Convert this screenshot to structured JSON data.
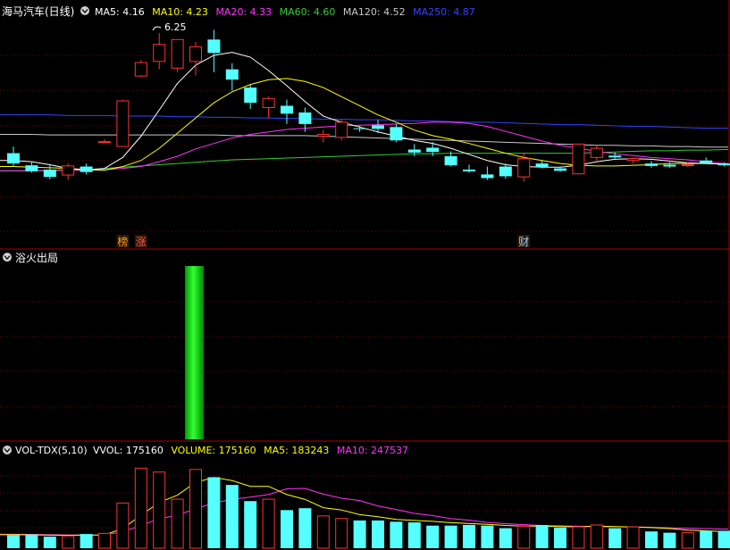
{
  "price_panel": {
    "title": "海马汽车(日线)",
    "indicators": [
      {
        "label": "MA5: 4.16",
        "color": "#ffffff"
      },
      {
        "label": "MA10: 4.23",
        "color": "#ffff00"
      },
      {
        "label": "MA20: 4.33",
        "color": "#ff33ff"
      },
      {
        "label": "MA60: 4.60",
        "color": "#33cc33"
      },
      {
        "label": "MA120: 4.52",
        "color": "#c8c8c8"
      },
      {
        "label": "MA250: 4.87",
        "color": "#3344ff"
      }
    ],
    "high_marker": "6.25",
    "badges": [
      {
        "text": "榜",
        "index": 6,
        "color": "#ff9933"
      },
      {
        "text": "涨",
        "index": 7,
        "color": "#ff5555"
      },
      {
        "text": "财",
        "index": 28,
        "color": "#99ccff"
      }
    ]
  },
  "signal_panel": {
    "title": "浴火出局",
    "signal_index": 10,
    "signal_level": 1.0
  },
  "volume_panel": {
    "title": "VOL-TDX(5,10)",
    "indicators": [
      {
        "label": "VVOL: 175160",
        "color": "#ffffff"
      },
      {
        "label": "VOLUME: 175160",
        "color": "#ffff00"
      },
      {
        "label": "MA5: 183243",
        "color": "#ffff00"
      },
      {
        "label": "MA10: 247537",
        "color": "#ff33ff"
      }
    ]
  },
  "colors": {
    "up": "#ff3333",
    "down": "#55ffff",
    "grid": "#7a0000",
    "ma5": "#ffffff",
    "ma10": "#ffff00",
    "ma20": "#ff33ff",
    "ma60": "#33cc33",
    "ma120": "#c8c8c8",
    "ma250": "#3344ff"
  },
  "chart_data": {
    "type": "candlestick",
    "price_range": [
      3.0,
      6.35
    ],
    "candles": [
      {
        "o": 4.27,
        "h": 4.38,
        "l": 4.05,
        "c": 4.1
      },
      {
        "o": 4.07,
        "h": 4.12,
        "l": 3.95,
        "c": 3.97
      },
      {
        "o": 4.0,
        "h": 4.07,
        "l": 3.84,
        "c": 3.88
      },
      {
        "o": 3.91,
        "h": 4.1,
        "l": 3.83,
        "c": 4.06
      },
      {
        "o": 4.05,
        "h": 4.1,
        "l": 3.92,
        "c": 3.96
      },
      {
        "o": 4.46,
        "h": 4.5,
        "l": 4.46,
        "c": 4.46
      },
      {
        "o": 4.38,
        "h": 5.15,
        "l": 4.38,
        "c": 5.13
      },
      {
        "o": 5.54,
        "h": 5.8,
        "l": 5.52,
        "c": 5.76
      },
      {
        "o": 5.78,
        "h": 6.25,
        "l": 5.65,
        "c": 6.06
      },
      {
        "o": 5.67,
        "h": 6.1,
        "l": 5.6,
        "c": 6.14
      },
      {
        "o": 5.78,
        "h": 6.1,
        "l": 5.55,
        "c": 6.02
      },
      {
        "o": 6.14,
        "h": 6.3,
        "l": 5.6,
        "c": 5.92
      },
      {
        "o": 5.65,
        "h": 5.75,
        "l": 5.3,
        "c": 5.48
      },
      {
        "o": 5.35,
        "h": 5.4,
        "l": 5.0,
        "c": 5.1
      },
      {
        "o": 5.02,
        "h": 5.2,
        "l": 4.85,
        "c": 5.17
      },
      {
        "o": 5.05,
        "h": 5.15,
        "l": 4.75,
        "c": 4.92
      },
      {
        "o": 4.94,
        "h": 5.02,
        "l": 4.62,
        "c": 4.75
      },
      {
        "o": 4.55,
        "h": 4.65,
        "l": 4.45,
        "c": 4.58
      },
      {
        "o": 4.53,
        "h": 4.82,
        "l": 4.48,
        "c": 4.78
      },
      {
        "o": 4.68,
        "h": 4.72,
        "l": 4.62,
        "c": 4.67
      },
      {
        "o": 4.73,
        "h": 4.82,
        "l": 4.6,
        "c": 4.67
      },
      {
        "o": 4.7,
        "h": 4.75,
        "l": 4.45,
        "c": 4.48
      },
      {
        "o": 4.33,
        "h": 4.42,
        "l": 4.22,
        "c": 4.28
      },
      {
        "o": 4.36,
        "h": 4.45,
        "l": 4.22,
        "c": 4.29
      },
      {
        "o": 4.22,
        "h": 4.3,
        "l": 4.05,
        "c": 4.07
      },
      {
        "o": 4.0,
        "h": 4.08,
        "l": 3.95,
        "c": 3.97
      },
      {
        "o": 3.92,
        "h": 4.05,
        "l": 3.83,
        "c": 3.86
      },
      {
        "o": 4.05,
        "h": 4.1,
        "l": 3.85,
        "c": 3.89
      },
      {
        "o": 3.88,
        "h": 4.28,
        "l": 3.8,
        "c": 4.18
      },
      {
        "o": 4.1,
        "h": 4.15,
        "l": 4.02,
        "c": 4.04
      },
      {
        "o": 4.02,
        "h": 4.05,
        "l": 3.96,
        "c": 3.98
      },
      {
        "o": 3.93,
        "h": 4.42,
        "l": 3.93,
        "c": 4.42
      },
      {
        "o": 4.2,
        "h": 4.4,
        "l": 4.15,
        "c": 4.35
      },
      {
        "o": 4.23,
        "h": 4.28,
        "l": 4.18,
        "c": 4.2
      },
      {
        "o": 4.15,
        "h": 4.2,
        "l": 4.1,
        "c": 4.18
      },
      {
        "o": 4.1,
        "h": 4.14,
        "l": 4.03,
        "c": 4.06
      },
      {
        "o": 4.08,
        "h": 4.12,
        "l": 4.03,
        "c": 4.05
      },
      {
        "o": 4.07,
        "h": 4.12,
        "l": 4.04,
        "c": 4.08
      },
      {
        "o": 4.15,
        "h": 4.2,
        "l": 4.1,
        "c": 4.11
      },
      {
        "o": 4.1,
        "h": 4.12,
        "l": 4.05,
        "c": 4.07
      }
    ],
    "ma5": [
      4.15,
      4.13,
      4.08,
      4.02,
      3.99,
      4.02,
      4.2,
      4.55,
      4.98,
      5.42,
      5.72,
      5.88,
      5.93,
      5.85,
      5.63,
      5.38,
      5.12,
      4.88,
      4.78,
      4.7,
      4.62,
      4.55,
      4.48,
      4.43,
      4.35,
      4.25,
      4.15,
      4.08,
      4.05,
      4.04,
      4.04,
      4.07,
      4.13,
      4.17,
      4.18,
      4.17,
      4.14,
      4.11,
      4.1,
      4.09
    ],
    "ma10": [
      4.05,
      4.04,
      4.03,
      4.02,
      4.0,
      3.99,
      4.05,
      4.15,
      4.35,
      4.6,
      4.85,
      5.1,
      5.28,
      5.4,
      5.48,
      5.5,
      5.45,
      5.35,
      5.2,
      5.05,
      4.9,
      4.78,
      4.65,
      4.56,
      4.5,
      4.43,
      4.35,
      4.27,
      4.2,
      4.15,
      4.1,
      4.07,
      4.06,
      4.06,
      4.07,
      4.08,
      4.1,
      4.1,
      4.1,
      4.09
    ],
    "ma20": [
      3.98,
      3.98,
      3.99,
      3.99,
      3.99,
      4.0,
      4.02,
      4.05,
      4.13,
      4.22,
      4.34,
      4.43,
      4.52,
      4.58,
      4.62,
      4.66,
      4.68,
      4.7,
      4.72,
      4.73,
      4.74,
      4.75,
      4.76,
      4.78,
      4.78,
      4.76,
      4.71,
      4.63,
      4.55,
      4.47,
      4.4,
      4.35,
      4.3,
      4.26,
      4.23,
      4.2,
      4.18,
      4.16,
      4.13,
      4.1
    ],
    "ma60": [
      3.98,
      3.98,
      3.98,
      3.99,
      4.0,
      4.02,
      4.04,
      4.06,
      4.08,
      4.1,
      4.12,
      4.14,
      4.16,
      4.17,
      4.18,
      4.19,
      4.2,
      4.21,
      4.22,
      4.23,
      4.24,
      4.25,
      4.26,
      4.26,
      4.27,
      4.27,
      4.27,
      4.27,
      4.27,
      4.27,
      4.27,
      4.27,
      4.28,
      4.29,
      4.3,
      4.31,
      4.31,
      4.32,
      4.32,
      4.33
    ],
    "ma120": [
      4.58,
      4.58,
      4.57,
      4.57,
      4.57,
      4.57,
      4.57,
      4.57,
      4.57,
      4.57,
      4.57,
      4.57,
      4.56,
      4.56,
      4.56,
      4.56,
      4.56,
      4.55,
      4.54,
      4.53,
      4.52,
      4.51,
      4.5,
      4.49,
      4.48,
      4.47,
      4.46,
      4.45,
      4.44,
      4.43,
      4.42,
      4.41,
      4.4,
      4.4,
      4.39,
      4.39,
      4.38,
      4.38,
      4.37,
      4.37
    ],
    "ma250": [
      4.9,
      4.9,
      4.9,
      4.89,
      4.89,
      4.89,
      4.88,
      4.88,
      4.88,
      4.87,
      4.87,
      4.86,
      4.86,
      4.85,
      4.85,
      4.84,
      4.84,
      4.83,
      4.83,
      4.82,
      4.82,
      4.81,
      4.8,
      4.8,
      4.79,
      4.78,
      4.78,
      4.77,
      4.76,
      4.75,
      4.74,
      4.74,
      4.73,
      4.72,
      4.71,
      4.71,
      4.7,
      4.69,
      4.68,
      4.68
    ],
    "volume_max": 650000,
    "volume": [
      100000,
      105000,
      90000,
      95000,
      110000,
      115000,
      350000,
      620000,
      590000,
      380000,
      610000,
      550000,
      490000,
      365000,
      380000,
      295000,
      310000,
      250000,
      230000,
      215000,
      215000,
      205000,
      200000,
      175000,
      175000,
      180000,
      175000,
      155000,
      170000,
      180000,
      160000,
      165000,
      180000,
      155000,
      165000,
      130000,
      120000,
      120000,
      135000,
      135000
    ],
    "vol_ma5": [
      105000,
      104000,
      101000,
      100000,
      102000,
      103000,
      152000,
      256000,
      355000,
      411000,
      510000,
      548000,
      524000,
      479000,
      479000,
      416000,
      378000,
      314000,
      296000,
      260000,
      244000,
      223000,
      215000,
      208000,
      198000,
      191000,
      185000,
      176000,
      171000,
      171000,
      168000,
      166000,
      171000,
      168000,
      164000,
      160000,
      152000,
      140000,
      135000,
      128000
    ],
    "vol_ma10": [
      108000,
      107000,
      105000,
      103000,
      101000,
      102000,
      129000,
      175000,
      229000,
      255000,
      306000,
      350000,
      378000,
      396000,
      416000,
      460000,
      463000,
      419000,
      387000,
      369000,
      327000,
      300000,
      270000,
      252000,
      229000,
      217000,
      200000,
      190000,
      182000,
      176000,
      174000,
      170000,
      168000,
      166000,
      165000,
      162000,
      158000,
      155000,
      151000,
      148000
    ],
    "x_labels": []
  }
}
